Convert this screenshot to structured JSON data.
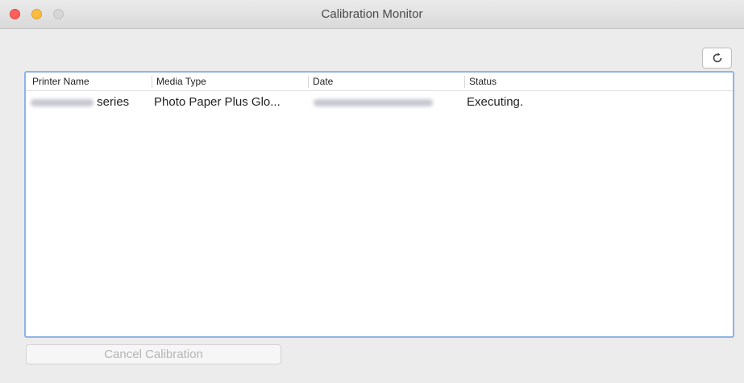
{
  "window": {
    "title": "Calibration Monitor"
  },
  "table": {
    "columns": [
      "Printer Name",
      "Media Type",
      "Date",
      "Status"
    ],
    "rows": [
      {
        "printer_name_suffix": "series",
        "media_type": "Photo Paper Plus Glo...",
        "status": "Executing."
      }
    ]
  },
  "buttons": {
    "cancel_label": "Cancel Calibration"
  },
  "icons": {
    "refresh": "refresh-icon"
  }
}
